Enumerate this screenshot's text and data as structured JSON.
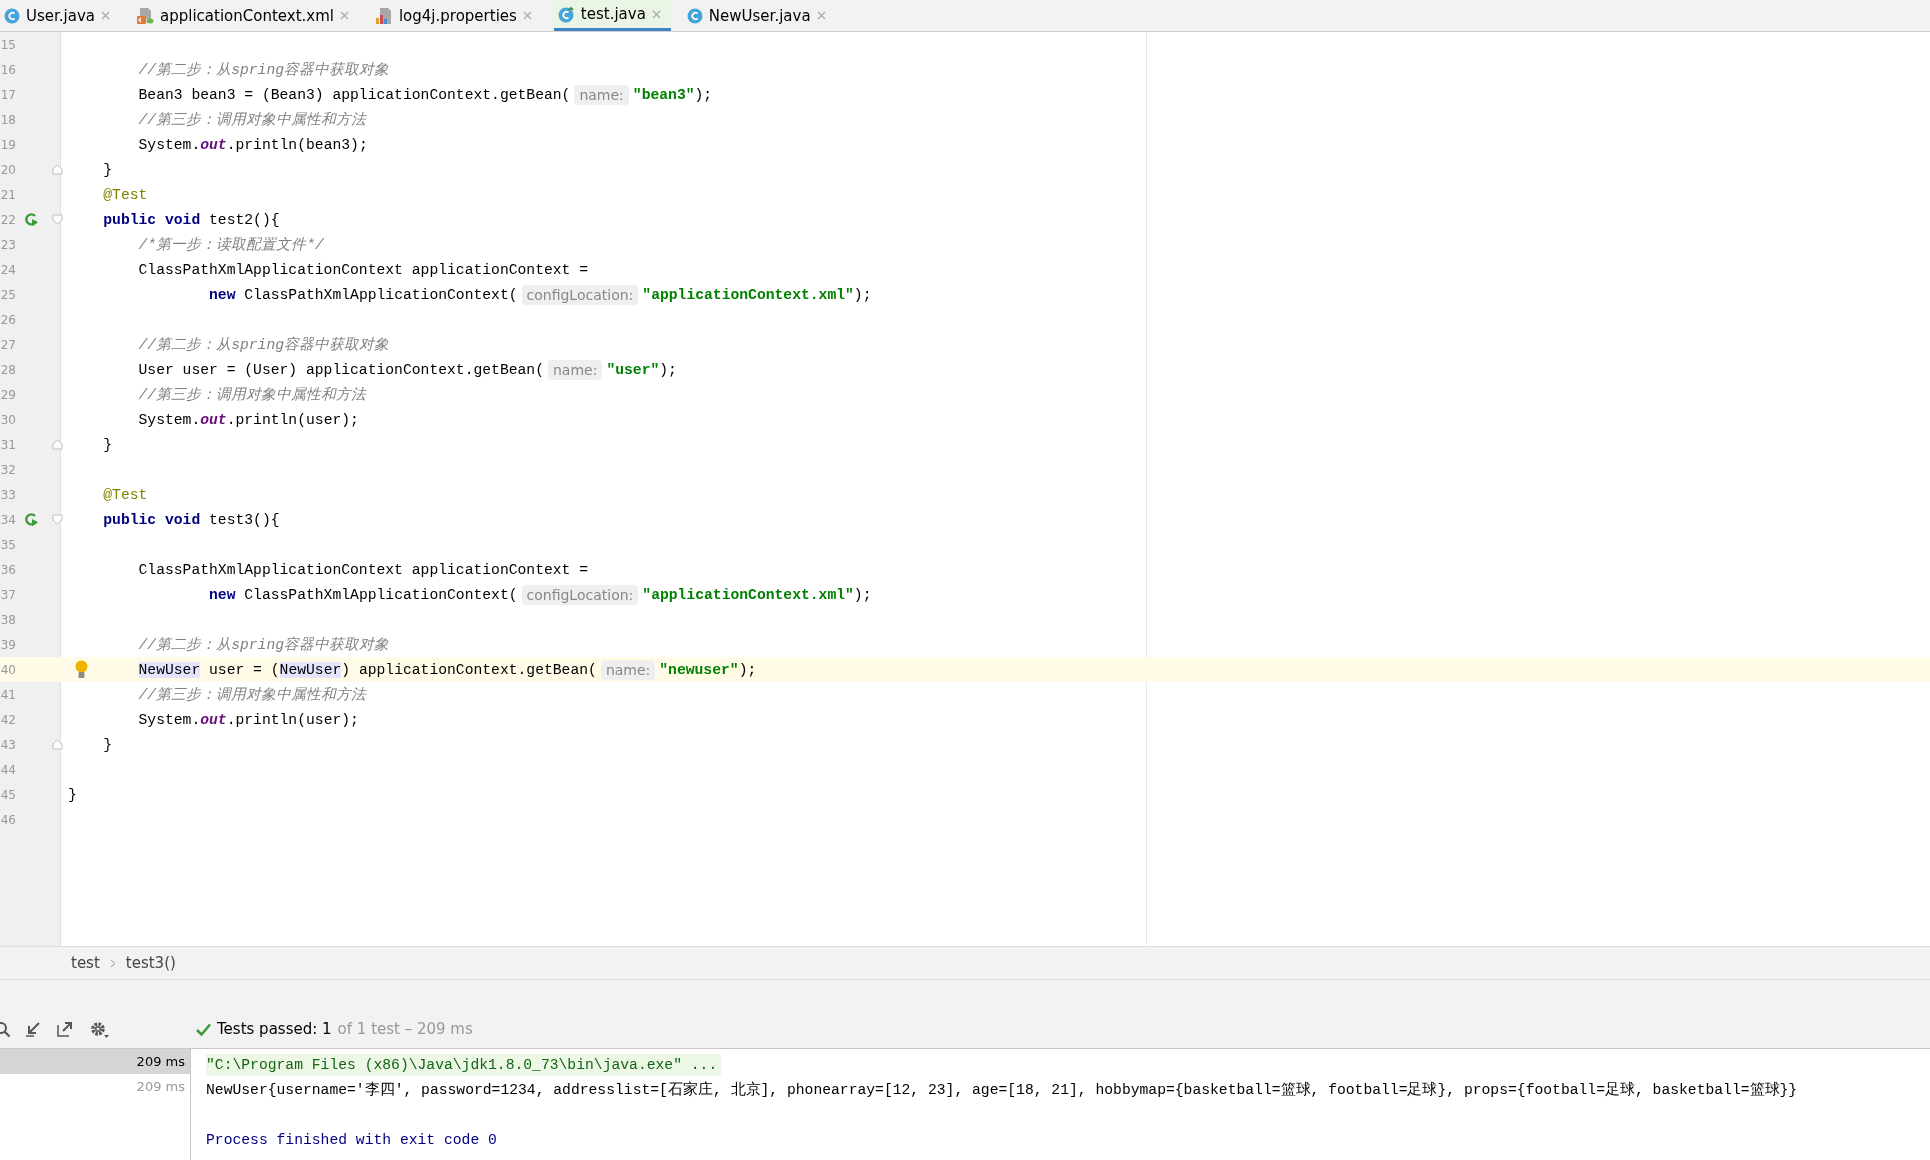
{
  "tabs": [
    {
      "label": "User.java",
      "kind": "class",
      "selected": false
    },
    {
      "label": "applicationContext.xml",
      "kind": "xml",
      "selected": false
    },
    {
      "label": "log4j.properties",
      "kind": "properties",
      "selected": false
    },
    {
      "label": "test.java",
      "kind": "test",
      "selected": true
    },
    {
      "label": "NewUser.java",
      "kind": "class",
      "selected": false
    }
  ],
  "editor": {
    "lines": [
      {
        "n": "15",
        "current": false
      },
      {
        "n": "16",
        "current": false,
        "code": [
          {
            "kind": "comment",
            "text": "        //第二步：从spring容器中获取对象"
          }
        ]
      },
      {
        "n": "17",
        "current": false,
        "code": [
          {
            "kind": "plain",
            "text": "        Bean3 bean3 = (Bean3) applicationContext.getBean("
          },
          {
            "kind": "hint",
            "text": "name:"
          },
          {
            "kind": "string",
            "text": "\"bean3\""
          },
          {
            "kind": "plain",
            "text": ");"
          }
        ]
      },
      {
        "n": "18",
        "current": false,
        "code": [
          {
            "kind": "comment",
            "text": "        //第三步：调用对象中属性和方法"
          }
        ]
      },
      {
        "n": "19",
        "current": false,
        "code": [
          {
            "kind": "plain",
            "text": "        System."
          },
          {
            "kind": "field",
            "text": "out"
          },
          {
            "kind": "plain",
            "text": ".println(bean3);"
          }
        ]
      },
      {
        "n": "20",
        "current": false,
        "gutter": [
          {
            "kind": "foldend"
          }
        ],
        "code": [
          {
            "kind": "plain",
            "text": "    }"
          }
        ]
      },
      {
        "n": "21",
        "current": false,
        "code": [
          {
            "kind": "annotation",
            "text": "    @Test"
          }
        ]
      },
      {
        "n": "22",
        "current": false,
        "gutter": [
          {
            "kind": "run"
          },
          {
            "kind": "foldstart"
          }
        ],
        "code": [
          {
            "kind": "keyword",
            "text": "    public void "
          },
          {
            "kind": "plain",
            "text": "test2(){"
          }
        ]
      },
      {
        "n": "23",
        "current": false,
        "code": [
          {
            "kind": "comment",
            "text": "        /*第一步：读取配置文件*/"
          }
        ]
      },
      {
        "n": "24",
        "current": false,
        "code": [
          {
            "kind": "plain",
            "text": "        ClassPathXmlApplicationContext applicationContext ="
          }
        ]
      },
      {
        "n": "25",
        "current": false,
        "code": [
          {
            "kind": "keyword",
            "text": "                new "
          },
          {
            "kind": "plain",
            "text": "ClassPathXmlApplicationContext("
          },
          {
            "kind": "hint",
            "text": "configLocation:"
          },
          {
            "kind": "string",
            "text": "\"applicationContext.xml\""
          },
          {
            "kind": "plain",
            "text": ");"
          }
        ]
      },
      {
        "n": "26",
        "current": false
      },
      {
        "n": "27",
        "current": false,
        "code": [
          {
            "kind": "comment",
            "text": "        //第二步：从spring容器中获取对象"
          }
        ]
      },
      {
        "n": "28",
        "current": false,
        "code": [
          {
            "kind": "plain",
            "text": "        User user = (User) applicationContext.getBean("
          },
          {
            "kind": "hint",
            "text": "name:"
          },
          {
            "kind": "string",
            "text": "\"user\""
          },
          {
            "kind": "plain",
            "text": ");"
          }
        ]
      },
      {
        "n": "29",
        "current": false,
        "code": [
          {
            "kind": "comment",
            "text": "        //第三步：调用对象中属性和方法"
          }
        ]
      },
      {
        "n": "30",
        "current": false,
        "code": [
          {
            "kind": "plain",
            "text": "        System."
          },
          {
            "kind": "field",
            "text": "out"
          },
          {
            "kind": "plain",
            "text": ".println(user);"
          }
        ]
      },
      {
        "n": "31",
        "current": false,
        "gutter": [
          {
            "kind": "foldend"
          }
        ],
        "code": [
          {
            "kind": "plain",
            "text": "    }"
          }
        ]
      },
      {
        "n": "32",
        "current": false
      },
      {
        "n": "33",
        "current": false,
        "code": [
          {
            "kind": "annotation",
            "text": "    @Test"
          }
        ]
      },
      {
        "n": "34",
        "current": false,
        "gutter": [
          {
            "kind": "run"
          },
          {
            "kind": "foldstart"
          }
        ],
        "code": [
          {
            "kind": "keyword",
            "text": "    public void "
          },
          {
            "kind": "plain",
            "text": "test3(){"
          }
        ]
      },
      {
        "n": "35",
        "current": false
      },
      {
        "n": "36",
        "current": false,
        "code": [
          {
            "kind": "plain",
            "text": "        ClassPathXmlApplicationContext applicationContext ="
          }
        ]
      },
      {
        "n": "37",
        "current": false,
        "code": [
          {
            "kind": "keyword",
            "text": "                new "
          },
          {
            "kind": "plain",
            "text": "ClassPathXmlApplicationContext("
          },
          {
            "kind": "hint",
            "text": "configLocation:"
          },
          {
            "kind": "string",
            "text": "\"applicationContext.xml\""
          },
          {
            "kind": "plain",
            "text": ");"
          }
        ]
      },
      {
        "n": "38",
        "current": false
      },
      {
        "n": "39",
        "current": false,
        "code": [
          {
            "kind": "comment",
            "text": "        //第二步：从spring容器中获取对象"
          }
        ]
      },
      {
        "n": "40",
        "current": true,
        "gutter": [
          {
            "kind": "bulb"
          }
        ],
        "code": [
          {
            "kind": "reference",
            "text": "        NewUser"
          },
          {
            "kind": "plain",
            "text": " user = ("
          },
          {
            "kind": "reference",
            "text": "NewUser"
          },
          {
            "kind": "plain",
            "text": ") applicationContext.getBean("
          },
          {
            "kind": "hint",
            "text": "name:"
          },
          {
            "kind": "string",
            "text": "\"newuser\""
          },
          {
            "kind": "plain",
            "text": ");"
          }
        ]
      },
      {
        "n": "41",
        "current": false,
        "code": [
          {
            "kind": "comment",
            "text": "        //第三步：调用对象中属性和方法"
          }
        ]
      },
      {
        "n": "42",
        "current": false,
        "code": [
          {
            "kind": "plain",
            "text": "        System."
          },
          {
            "kind": "field",
            "text": "out"
          },
          {
            "kind": "plain",
            "text": ".println(user);"
          }
        ]
      },
      {
        "n": "43",
        "current": false,
        "gutter": [
          {
            "kind": "foldend"
          }
        ],
        "code": [
          {
            "kind": "plain",
            "text": "    }"
          }
        ]
      },
      {
        "n": "44",
        "current": false
      },
      {
        "n": "45",
        "current": false,
        "code": [
          {
            "kind": "plain",
            "text": "}"
          }
        ]
      },
      {
        "n": "46",
        "current": false
      }
    ]
  },
  "breadcrumb": [
    "test",
    "test3()"
  ],
  "run": {
    "status": {
      "passed": "Tests passed: 1",
      "detail": "of 1 test – 209 ms"
    },
    "tests": [
      {
        "time": "209 ms",
        "selected": true
      },
      {
        "time": "209 ms",
        "selected": false
      }
    ],
    "console": [
      {
        "kind": "command",
        "text": "\"C:\\Program Files (x86)\\Java\\jdk1.8.0_73\\bin\\java.exe\" ..."
      },
      {
        "kind": "output",
        "text": "NewUser{username='李四', password=1234, addresslist=[石家庄, 北京], phonearray=[12, 23], age=[18, 21], hobbymap={basketball=篮球, football=足球}, props={football=足球, basketball=篮球}}"
      },
      {
        "kind": "exit",
        "text": "Process finished with exit code 0"
      }
    ]
  }
}
